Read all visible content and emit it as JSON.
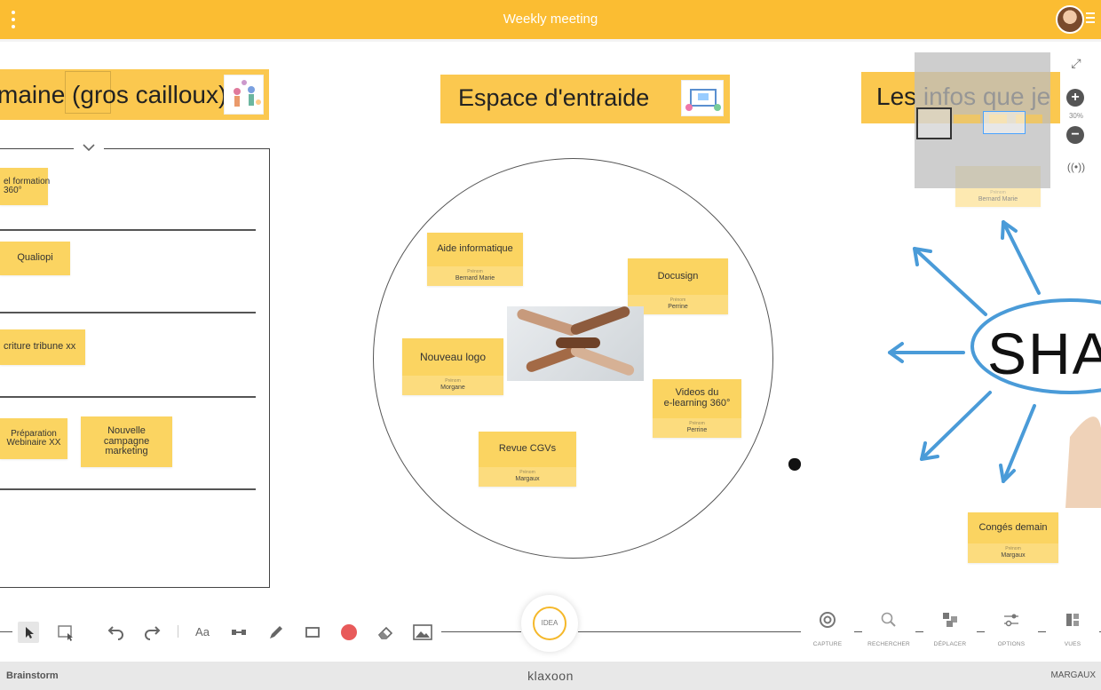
{
  "app": {
    "title": "Weekly meeting",
    "brand": "klaxoon",
    "activity": "Brainstorm",
    "user": "MARGAUX",
    "accent": "#fbbd32"
  },
  "board": {
    "headers": [
      {
        "text": "maine (gros cailloux)"
      },
      {
        "text": "Espace d'entraide"
      },
      {
        "text": "Les infos que je"
      }
    ],
    "lanes": {
      "collapse_icon": "chevron-down-icon",
      "notes": [
        {
          "text": "el formation\n360°"
        },
        {
          "text": "Qualiopi"
        },
        {
          "text": "criture tribune xx"
        },
        {
          "text": "Préparation\nWebinaire XX"
        },
        {
          "text": "Nouvelle\ncampagne\nmarketing"
        }
      ]
    },
    "circle_notes": [
      {
        "text": "Aide informatique",
        "author_label": "Prénom",
        "author": "Bernard Marie"
      },
      {
        "text": "Docusign",
        "author_label": "Prénom",
        "author": "Perrine"
      },
      {
        "text": "Nouveau logo",
        "author_label": "Prénom",
        "author": "Morgane"
      },
      {
        "text": "Videos du\ne-learning 360°",
        "author_label": "Prénom",
        "author": "Perrine"
      },
      {
        "text": "Revue CGVs",
        "author_label": "Prénom",
        "author": "Margaux"
      }
    ],
    "right_notes": [
      {
        "text": "",
        "author_label": "Prénom",
        "author": "Bernard Marie"
      },
      {
        "text": "Congés demain",
        "author_label": "Prénom",
        "author": "Margaux"
      }
    ],
    "share_word": "SHA"
  },
  "zoom": {
    "percent": "30%",
    "fullscreen_icon": "expand-icon",
    "zoom_in_icon": "plus-icon",
    "zoom_out_icon": "minus-icon",
    "live_icon": "broadcast-icon"
  },
  "toolbar": {
    "idea_label": "IDEA",
    "tools": [
      "select",
      "multi-select",
      "undo",
      "redo",
      "text",
      "connector",
      "pen",
      "shape",
      "color",
      "eraser",
      "image"
    ],
    "text_tool_label": "Aa",
    "color_value": "#e85a5a",
    "right": [
      {
        "label": "CAPTURE",
        "icon": "aperture-icon"
      },
      {
        "label": "RECHERCHER",
        "icon": "search-icon"
      },
      {
        "label": "DÉPLACER",
        "icon": "move-icon"
      },
      {
        "label": "OPTIONS",
        "icon": "sliders-icon"
      },
      {
        "label": "VUES",
        "icon": "views-icon"
      }
    ]
  }
}
